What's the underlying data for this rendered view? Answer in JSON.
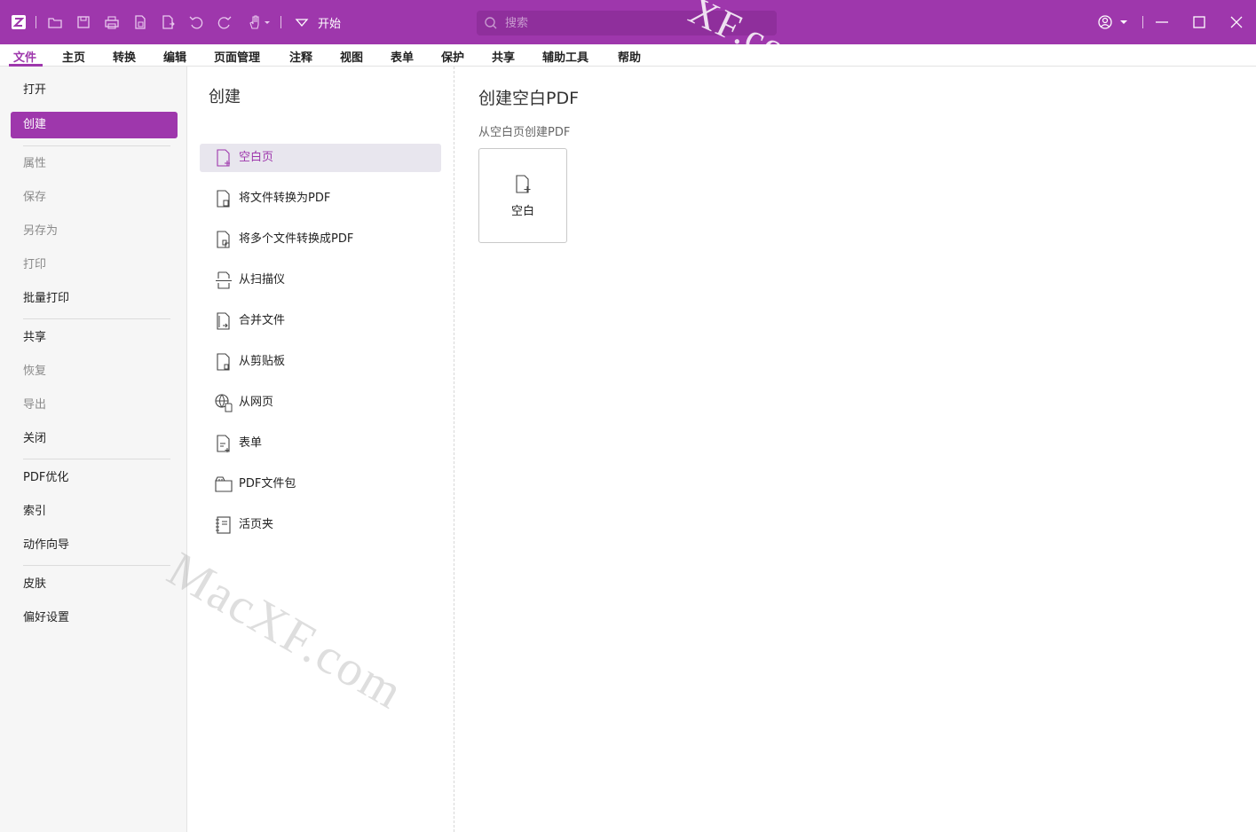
{
  "titlebar": {
    "start_label": "开始",
    "search_placeholder": "搜索",
    "watermark": "XF.com",
    "accent": "#9e37ac",
    "icons": [
      "app-logo-icon",
      "open-folder-icon",
      "save-icon",
      "print-icon",
      "new-doc-icon",
      "export-icon",
      "undo-icon",
      "redo-icon",
      "hand-tool-icon",
      "quick-access-dropdown-icon",
      "account-icon",
      "minimize-icon",
      "maximize-icon",
      "close-icon"
    ]
  },
  "menubar": {
    "items": [
      "文件",
      "主页",
      "转换",
      "编辑",
      "页面管理",
      "注释",
      "视图",
      "表单",
      "保护",
      "共享",
      "辅助工具",
      "帮助"
    ],
    "active_index": 0
  },
  "leftnav": {
    "items": [
      {
        "label": "打开",
        "state": "normal"
      },
      {
        "label": "创建",
        "state": "selected"
      },
      {
        "label": "属性",
        "state": "disabled"
      },
      {
        "label": "保存",
        "state": "disabled"
      },
      {
        "label": "另存为",
        "state": "disabled"
      },
      {
        "label": "打印",
        "state": "disabled"
      },
      {
        "label": "批量打印",
        "state": "normal"
      },
      {
        "label": "共享",
        "state": "normal"
      },
      {
        "label": "恢复",
        "state": "disabled"
      },
      {
        "label": "导出",
        "state": "disabled"
      },
      {
        "label": "关闭",
        "state": "normal"
      },
      {
        "label": "PDF优化",
        "state": "normal"
      },
      {
        "label": "索引",
        "state": "normal"
      },
      {
        "label": "动作向导",
        "state": "normal"
      },
      {
        "label": "皮肤",
        "state": "normal"
      },
      {
        "label": "偏好设置",
        "state": "normal"
      }
    ]
  },
  "midpanel": {
    "title": "创建",
    "items": [
      {
        "label": "空白页",
        "icon": "blank-page-icon",
        "selected": true
      },
      {
        "label": "将文件转换为PDF",
        "icon": "convert-file-icon"
      },
      {
        "label": "将多个文件转换成PDF",
        "icon": "convert-multiple-files-icon"
      },
      {
        "label": "从扫描仪",
        "icon": "scanner-icon"
      },
      {
        "label": "合并文件",
        "icon": "merge-files-icon"
      },
      {
        "label": "从剪贴板",
        "icon": "clipboard-icon"
      },
      {
        "label": "从网页",
        "icon": "web-page-icon"
      },
      {
        "label": "表单",
        "icon": "form-icon"
      },
      {
        "label": "PDF文件包",
        "icon": "pdf-portfolio-icon"
      },
      {
        "label": "活页夹",
        "icon": "binder-icon"
      }
    ],
    "watermark": "MacXF.com"
  },
  "rightpanel": {
    "title": "创建空白PDF",
    "subtitle": "从空白页创建PDF",
    "card_label": "空白"
  }
}
